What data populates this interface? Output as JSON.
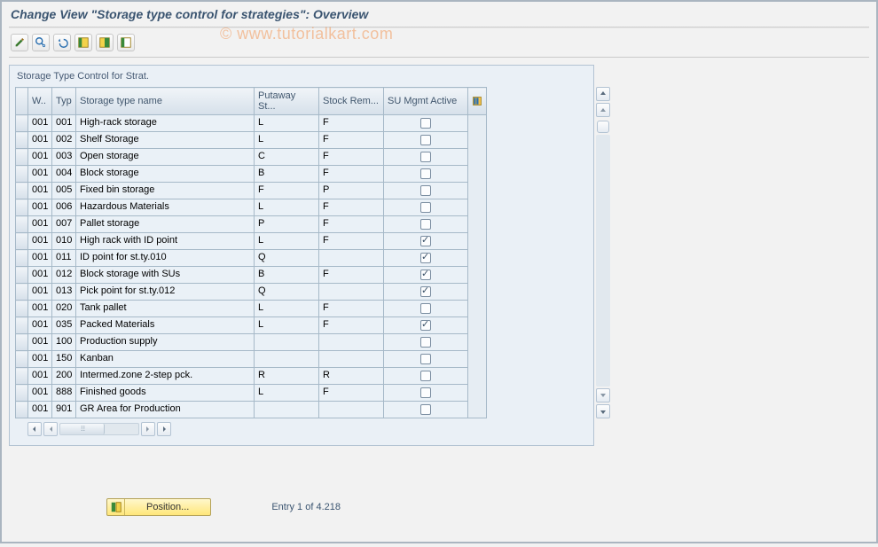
{
  "title": "Change View \"Storage type control for strategies\": Overview",
  "watermark": "© www.tutorialkart.com",
  "toolbar": {
    "icons": [
      "change-icon",
      "details-icon",
      "undo-icon",
      "select-all-icon",
      "select-block-icon",
      "deselect-all-icon"
    ]
  },
  "container": {
    "title": "Storage Type Control for Strat."
  },
  "headers": {
    "w": "W..",
    "typ": "Typ",
    "name": "Storage type name",
    "putaway": "Putaway St...",
    "stockrem": "Stock Rem...",
    "su": "SU Mgmt Active"
  },
  "rows": [
    {
      "w": "001",
      "typ": "001",
      "name": "High-rack storage",
      "put": "L",
      "stk": "F",
      "su": false
    },
    {
      "w": "001",
      "typ": "002",
      "name": "Shelf Storage",
      "put": "L",
      "stk": "F",
      "su": false
    },
    {
      "w": "001",
      "typ": "003",
      "name": "Open storage",
      "put": "C",
      "stk": "F",
      "su": false
    },
    {
      "w": "001",
      "typ": "004",
      "name": "Block storage",
      "put": "B",
      "stk": "F",
      "su": false
    },
    {
      "w": "001",
      "typ": "005",
      "name": "Fixed bin storage",
      "put": "F",
      "stk": "P",
      "su": false
    },
    {
      "w": "001",
      "typ": "006",
      "name": "Hazardous Materials",
      "put": "L",
      "stk": "F",
      "su": false
    },
    {
      "w": "001",
      "typ": "007",
      "name": "Pallet storage",
      "put": "P",
      "stk": "F",
      "su": false
    },
    {
      "w": "001",
      "typ": "010",
      "name": "High rack with ID point",
      "put": "L",
      "stk": "F",
      "su": true
    },
    {
      "w": "001",
      "typ": "011",
      "name": "ID point for st.ty.010",
      "put": "Q",
      "stk": "",
      "su": true
    },
    {
      "w": "001",
      "typ": "012",
      "name": "Block storage with SUs",
      "put": "B",
      "stk": "F",
      "su": true
    },
    {
      "w": "001",
      "typ": "013",
      "name": "Pick point for st.ty.012",
      "put": "Q",
      "stk": "",
      "su": true
    },
    {
      "w": "001",
      "typ": "020",
      "name": "Tank pallet",
      "put": "L",
      "stk": "F",
      "su": false
    },
    {
      "w": "001",
      "typ": "035",
      "name": "Packed Materials",
      "put": "L",
      "stk": "F",
      "su": true
    },
    {
      "w": "001",
      "typ": "100",
      "name": "Production supply",
      "put": "",
      "stk": "",
      "su": false
    },
    {
      "w": "001",
      "typ": "150",
      "name": "Kanban",
      "put": "",
      "stk": "",
      "su": false
    },
    {
      "w": "001",
      "typ": "200",
      "name": "Intermed.zone 2-step pck.",
      "put": "R",
      "stk": "R",
      "su": false
    },
    {
      "w": "001",
      "typ": "888",
      "name": "Finished goods",
      "put": "L",
      "stk": "F",
      "su": false
    },
    {
      "w": "001",
      "typ": "901",
      "name": "GR Area for Production",
      "put": "",
      "stk": "",
      "su": false
    }
  ],
  "footer": {
    "position_label": "Position...",
    "entry_text": "Entry 1 of 4.218"
  }
}
